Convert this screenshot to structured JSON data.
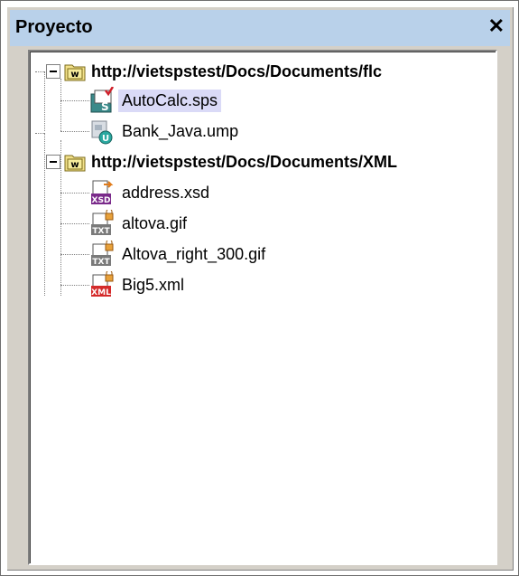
{
  "panel": {
    "title": "Proyecto",
    "close_glyph": "✕"
  },
  "tree": {
    "folders": [
      {
        "label": "http://vietspstest/Docs/Documents/flc",
        "icon": "webdav-folder-icon",
        "files": [
          {
            "label": "AutoCalc.sps",
            "icon": "sps-file-icon",
            "selected": true
          },
          {
            "label": "Bank_Java.ump",
            "icon": "ump-file-icon",
            "selected": false
          }
        ]
      },
      {
        "label": "http://vietspstest/Docs/Documents/XML",
        "icon": "webdav-folder-icon",
        "files": [
          {
            "label": "address.xsd",
            "icon": "xsd-file-icon",
            "selected": false
          },
          {
            "label": "altova.gif",
            "icon": "txt-file-icon",
            "selected": false
          },
          {
            "label": "Altova_right_300.gif",
            "icon": "txt-file-icon",
            "selected": false
          },
          {
            "label": "Big5.xml",
            "icon": "xml-file-icon",
            "selected": false
          }
        ]
      }
    ]
  },
  "colors": {
    "titlebar": "#b9d1ea",
    "selection": "#dadaf7",
    "panel_bg": "#d4d0c8"
  }
}
